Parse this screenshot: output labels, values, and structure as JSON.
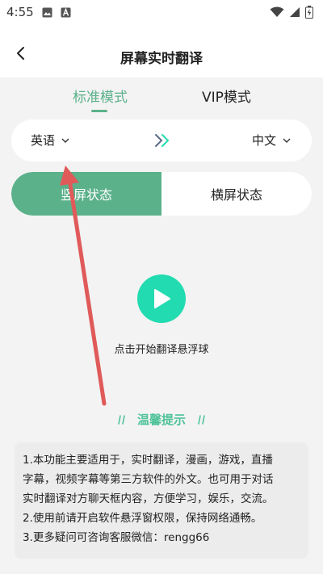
{
  "status_bar": {
    "time": "4:55",
    "icons": [
      "image-icon",
      "a-letter-icon",
      "wifi-icon",
      "signal-icon",
      "battery-charging-icon"
    ]
  },
  "header": {
    "title": "屏幕实时翻译",
    "back_icon": "chevron-left-icon"
  },
  "mode_tabs": {
    "standard_label": "标准模式",
    "vip_label": "VIP模式",
    "active": "standard"
  },
  "language_bar": {
    "source": "英语",
    "target": "中文",
    "swap_icon": "double-chevron-right-icon"
  },
  "orientation": {
    "portrait_label": "竖屏状态",
    "landscape_label": "横屏状态",
    "active": "portrait"
  },
  "start": {
    "caption": "点击开始翻译悬浮球"
  },
  "tips": {
    "title": "温馨提示",
    "lines": [
      "1.本功能主要适用于，实时翻译，漫画，游戏，直播",
      "字幕，视频字幕等第三方软件的外文。也可用于对话",
      "实时翻译对方聊天框内容，方便学习，娱乐，交流。",
      "2.使用前请开启软件悬浮窗权限，保持网络通畅。",
      "3.更多疑问可咨询客服微信：rengg66"
    ]
  },
  "colors": {
    "accent": "#5bb18a",
    "play": "#22dbb0",
    "tips_title": "#4fc39a",
    "annotation_arrow": "#e05a5a"
  }
}
